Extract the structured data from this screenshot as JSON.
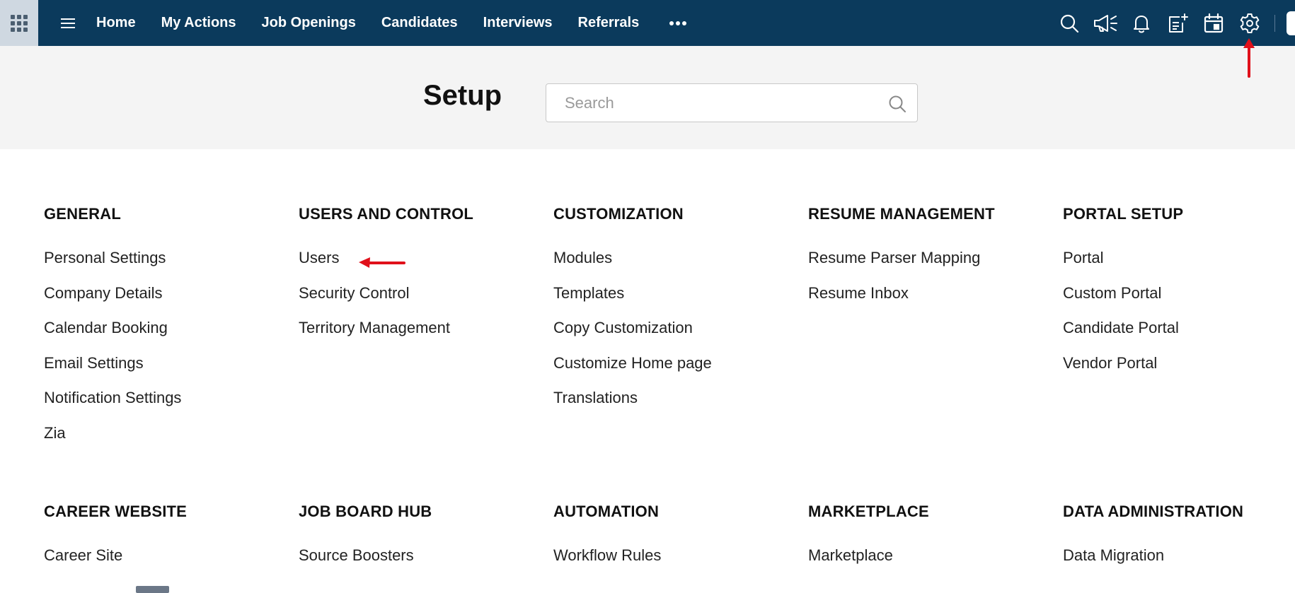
{
  "theme": {
    "nav_bg": "#0b3a5c",
    "header_bg": "#f4f4f4",
    "annotation_red": "#e0101a"
  },
  "navbar": {
    "apps_icon": "apps-grid-icon",
    "menu_icon": "hamburger-menu-icon",
    "links": [
      {
        "label": "Home"
      },
      {
        "label": "My Actions"
      },
      {
        "label": "Job Openings"
      },
      {
        "label": "Candidates"
      },
      {
        "label": "Interviews"
      },
      {
        "label": "Referrals"
      }
    ],
    "more_icon": "more-horizontal-icon",
    "right_icons": [
      "search-icon",
      "announcement-megaphone-icon",
      "notification-bell-icon",
      "add-note-icon",
      "calendar-icon",
      "settings-gear-icon"
    ]
  },
  "setup": {
    "title": "Setup",
    "search_placeholder": "Search"
  },
  "sections_row_1": [
    {
      "title": "GENERAL",
      "items": [
        "Personal Settings",
        "Company Details",
        "Calendar Booking",
        "Email Settings",
        "Notification Settings",
        "Zia"
      ]
    },
    {
      "title": "USERS AND CONTROL",
      "items": [
        "Users",
        "Security Control",
        "Territory Management"
      ]
    },
    {
      "title": "CUSTOMIZATION",
      "items": [
        "Modules",
        "Templates",
        "Copy Customization",
        "Customize Home page",
        "Translations"
      ]
    },
    {
      "title": "RESUME MANAGEMENT",
      "items": [
        "Resume Parser Mapping",
        "Resume Inbox"
      ]
    },
    {
      "title": "PORTAL SETUP",
      "items": [
        "Portal",
        "Custom Portal",
        "Candidate Portal",
        "Vendor Portal"
      ]
    }
  ],
  "sections_row_2": [
    {
      "title": "CAREER WEBSITE",
      "items": [
        "Career Site"
      ]
    },
    {
      "title": "JOB BOARD HUB",
      "items": [
        "Source Boosters"
      ]
    },
    {
      "title": "AUTOMATION",
      "items": [
        "Workflow Rules"
      ]
    },
    {
      "title": "MARKETPLACE",
      "items": [
        "Marketplace"
      ]
    },
    {
      "title": "DATA ADMINISTRATION",
      "items": [
        "Data Migration"
      ]
    }
  ],
  "annotations": [
    {
      "name": "arrow-pointing-to-settings",
      "icon": "red-up-arrow-icon"
    },
    {
      "name": "arrow-pointing-to-users",
      "icon": "red-left-arrow-icon"
    }
  ]
}
